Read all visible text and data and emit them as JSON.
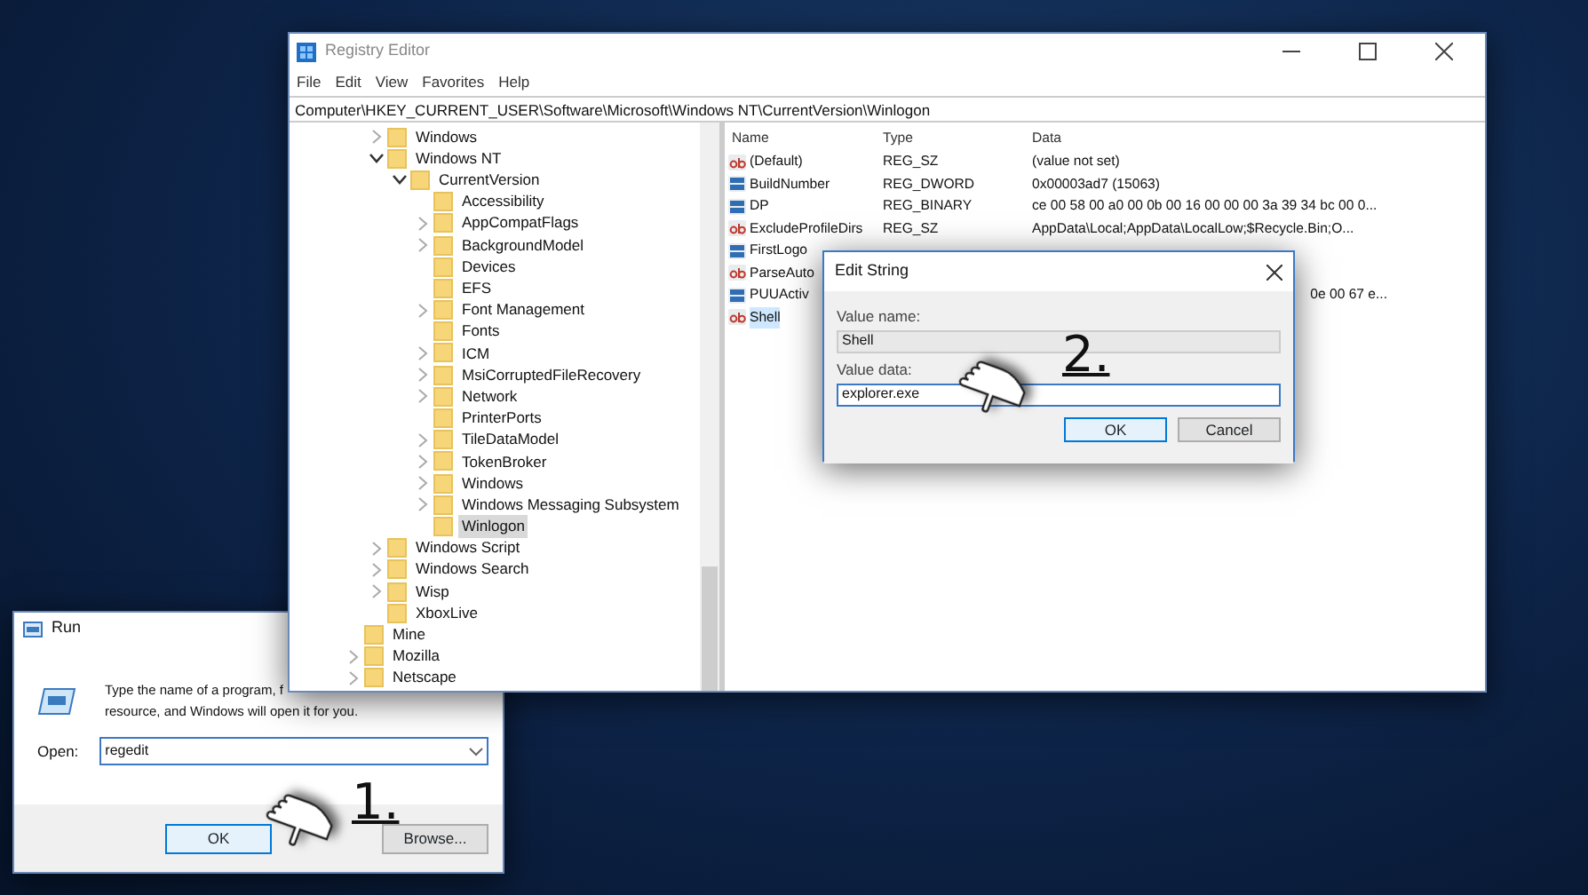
{
  "registry_editor": {
    "title": "Registry Editor",
    "menu": [
      "File",
      "Edit",
      "View",
      "Favorites",
      "Help"
    ],
    "address": "Computer\\HKEY_CURRENT_USER\\Software\\Microsoft\\Windows NT\\CurrentVersion\\Winlogon",
    "tree": [
      {
        "label": "Windows",
        "has_children": true,
        "expanded": false,
        "selected": false
      },
      {
        "label": "Windows NT",
        "has_children": true,
        "expanded": true,
        "selected": false,
        "children": [
          {
            "label": "CurrentVersion",
            "has_children": true,
            "expanded": true,
            "selected": false,
            "children": [
              {
                "label": "Accessibility",
                "has_children": false,
                "selected": false
              },
              {
                "label": "AppCompatFlags",
                "has_children": true,
                "expanded": false,
                "selected": false
              },
              {
                "label": "BackgroundModel",
                "has_children": true,
                "expanded": false,
                "selected": false
              },
              {
                "label": "Devices",
                "has_children": false,
                "selected": false
              },
              {
                "label": "EFS",
                "has_children": false,
                "selected": false
              },
              {
                "label": "Font Management",
                "has_children": true,
                "expanded": false,
                "selected": false
              },
              {
                "label": "Fonts",
                "has_children": false,
                "selected": false
              },
              {
                "label": "ICM",
                "has_children": true,
                "expanded": false,
                "selected": false
              },
              {
                "label": "MsiCorruptedFileRecovery",
                "has_children": true,
                "expanded": false,
                "selected": false
              },
              {
                "label": "Network",
                "has_children": true,
                "expanded": false,
                "selected": false
              },
              {
                "label": "PrinterPorts",
                "has_children": false,
                "selected": false
              },
              {
                "label": "TileDataModel",
                "has_children": true,
                "expanded": false,
                "selected": false
              },
              {
                "label": "TokenBroker",
                "has_children": true,
                "expanded": false,
                "selected": false
              },
              {
                "label": "Windows",
                "has_children": true,
                "expanded": false,
                "selected": false
              },
              {
                "label": "Windows Messaging Subsystem",
                "has_children": true,
                "expanded": false,
                "selected": false
              },
              {
                "label": "Winlogon",
                "has_children": false,
                "selected": true
              }
            ]
          }
        ]
      },
      {
        "label": "Windows Script",
        "has_children": true,
        "expanded": false,
        "selected": false
      },
      {
        "label": "Windows Search",
        "has_children": true,
        "expanded": false,
        "selected": false
      },
      {
        "label": "Wisp",
        "has_children": true,
        "expanded": false,
        "selected": false
      },
      {
        "label": "XboxLive",
        "has_children": false,
        "selected": false
      }
    ],
    "outer_tree": [
      {
        "label": "Mine",
        "has_children": false,
        "selected": false
      },
      {
        "label": "Mozilla",
        "has_children": true,
        "expanded": false,
        "selected": false
      },
      {
        "label": "Netscape",
        "has_children": true,
        "expanded": false,
        "selected": false
      }
    ],
    "columns": [
      "Name",
      "Type",
      "Data"
    ],
    "values": [
      {
        "kind": "string",
        "name": "(Default)",
        "type": "REG_SZ",
        "data": "(value not set)",
        "selected": false
      },
      {
        "kind": "binary",
        "name": "BuildNumber",
        "type": "REG_DWORD",
        "data": "0x00003ad7 (15063)",
        "selected": false
      },
      {
        "kind": "binary",
        "name": "DP",
        "type": "REG_BINARY",
        "data": "ce 00 58 00 a0 00 0b 00 16 00 00 00 3a 39 34 bc 00 0...",
        "selected": false
      },
      {
        "kind": "string",
        "name": "ExcludeProfileDirs",
        "type": "REG_SZ",
        "data": "AppData\\Local;AppData\\LocalLow;$Recycle.Bin;O...",
        "selected": false
      },
      {
        "kind": "binary",
        "name": "FirstLogo",
        "selected": false
      },
      {
        "kind": "string",
        "name": "ParseAuto",
        "selected": false
      },
      {
        "kind": "binary",
        "name": "PUUActiv",
        "data": "0e 00 67 e...",
        "selected": false
      },
      {
        "kind": "string",
        "name": "Shell",
        "selected": true
      }
    ]
  },
  "edit_string": {
    "title": "Edit String",
    "value_name_label": "Value name:",
    "value_name": "Shell",
    "value_data_label": "Value data:",
    "value_data": "explorer.exe",
    "buttons": [
      {
        "label": "OK",
        "default": true
      },
      {
        "label": "Cancel",
        "default": false
      }
    ]
  },
  "run_dialog": {
    "title": "Run",
    "description_line_1": "Type the name of a program, f",
    "description_line_2": "resource, and Windows will open it for you.",
    "open_label": "Open:",
    "open_value": "regedit",
    "buttons": [
      {
        "label": "OK",
        "default": true
      },
      {
        "label": "Browse...",
        "default": false
      }
    ]
  },
  "annotations": [
    "1.",
    "2."
  ]
}
